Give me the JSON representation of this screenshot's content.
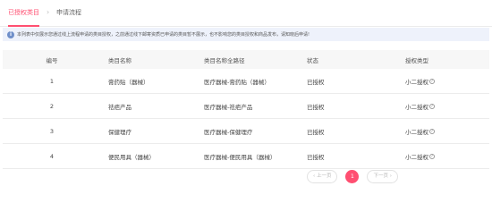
{
  "tabs": [
    {
      "label": "已授权类目"
    },
    {
      "label": "申请流程"
    }
  ],
  "tab_separator": "›",
  "notice": {
    "icon": "info-icon",
    "text": "本列表中仅展示您通过线上流程申请的类目授权，之前通过线下邮寄资质已申请的类目暂不展示，也不影响您的类目授权和商品发布，请知晓后申请!"
  },
  "table": {
    "headers": [
      "编号",
      "类目名称",
      "类目名称全路径",
      "状态",
      "授权类型"
    ],
    "rows": [
      {
        "id": "1",
        "name": "膏药贴（器械）",
        "path": "医疗器械-膏药贴（器械）",
        "status": "已授权",
        "type": "小二授权"
      },
      {
        "id": "2",
        "name": "祛疤产品",
        "path": "医疗器械-祛疤产品",
        "status": "已授权",
        "type": "小二授权"
      },
      {
        "id": "3",
        "name": "保健理疗",
        "path": "医疗器械-保健理疗",
        "status": "已授权",
        "type": "小二授权"
      },
      {
        "id": "4",
        "name": "便民用具（器械）",
        "path": "医疗器械-便民用具（器械）",
        "status": "已授权",
        "type": "小二授权"
      }
    ],
    "help_icon": "question-circle-icon"
  },
  "pagination": {
    "prev_label": "‹ 上一页",
    "current_page": "1",
    "next_label": "下一页 ›"
  },
  "colors": {
    "accent": "#ff4f71",
    "notice_bg": "#eef2fb",
    "header_bg": "#f7f7f7"
  }
}
